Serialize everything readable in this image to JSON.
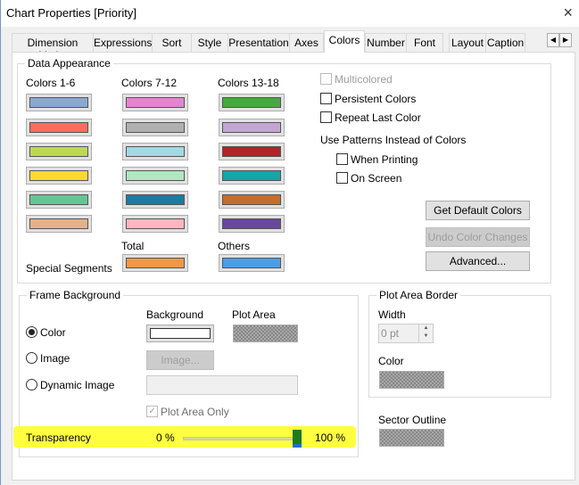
{
  "window": {
    "title": "Chart Properties [Priority]",
    "close_icon": "×"
  },
  "tabs": [
    {
      "label": "Dimension Limits"
    },
    {
      "label": "Expressions"
    },
    {
      "label": "Sort"
    },
    {
      "label": "Style"
    },
    {
      "label": "Presentation"
    },
    {
      "label": "Axes"
    },
    {
      "label": "Colors",
      "active": true
    },
    {
      "label": "Number"
    },
    {
      "label": "Font"
    },
    {
      "label": "Layout"
    },
    {
      "label": "Caption"
    }
  ],
  "tab_scroll": {
    "left": "◀",
    "right": "▶"
  },
  "data_appearance": {
    "legend": "Data Appearance",
    "col1_label": "Colors 1-6",
    "col2_label": "Colors 7-12",
    "col3_label": "Colors 13-18",
    "colors_1_6": [
      "#8aa9d0",
      "#ff6b5c",
      "#bdd953",
      "#ffd92f",
      "#66c595",
      "#e2b28c"
    ],
    "colors_7_12": [
      "#e485d1",
      "#b0b0b0",
      "#a4d8e3",
      "#b0e6c0",
      "#1c7ba0",
      "#ffb6c1"
    ],
    "colors_13_18": [
      "#47a842",
      "#c2a7d4",
      "#b2232a",
      "#13a7a6",
      "#c46d2d",
      "#66489c"
    ],
    "total_label": "Total",
    "others_label": "Others",
    "special_segments_label": "Special Segments",
    "total_color": "#f09848",
    "others_color": "#4b9ee6",
    "multicolored": {
      "label": "Multicolored",
      "checked": false,
      "disabled": true
    },
    "persistent_colors": {
      "label": "Persistent Colors",
      "checked": false
    },
    "repeat_last_color": {
      "label": "Repeat Last Color",
      "checked": false
    },
    "patterns_label": "Use Patterns Instead of Colors",
    "when_printing": {
      "label": "When Printing",
      "checked": false
    },
    "on_screen": {
      "label": "On Screen",
      "checked": false
    },
    "get_default_colors": "Get Default Colors",
    "undo_color_changes": "Undo Color Changes",
    "advanced": "Advanced..."
  },
  "frame_background": {
    "legend": "Frame Background",
    "background_label": "Background",
    "plot_area_label": "Plot Area",
    "options": [
      {
        "label": "Color",
        "selected": true
      },
      {
        "label": "Image",
        "selected": false
      },
      {
        "label": "Dynamic Image",
        "selected": false
      }
    ],
    "image_button": "Image...",
    "dynamic_image_value": "",
    "plot_area_only": {
      "label": "Plot Area Only",
      "checked": true,
      "disabled": true
    },
    "background_color": "#ffffff"
  },
  "transparency": {
    "label": "Transparency",
    "min_label": "0 %",
    "max_label": "100 %",
    "value_percent": 100,
    "highlight_color": "#ffff40",
    "thumb_color": "#1e7a1e"
  },
  "plot_area_border": {
    "legend": "Plot Area Border",
    "width_label": "Width",
    "width_value": "0 pt",
    "color_label": "Color"
  },
  "sector_outline": {
    "label": "Sector Outline"
  }
}
